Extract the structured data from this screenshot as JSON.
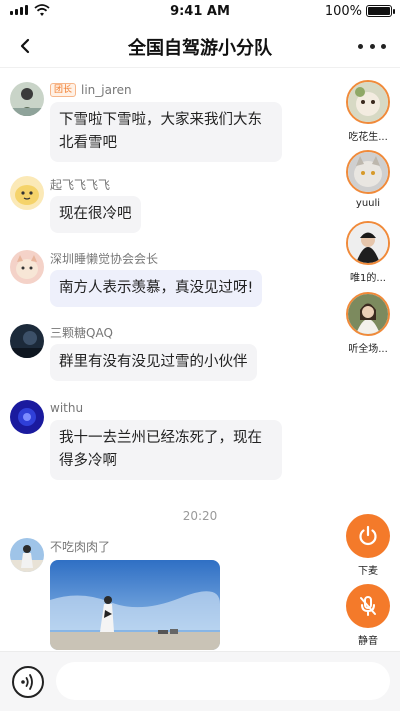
{
  "status_bar": {
    "time": "9:41 AM",
    "battery": "100%"
  },
  "header": {
    "title": "全国自驾游小分队",
    "back_icon": "chevron-left-icon",
    "more_icon": "more-horizontal-icon"
  },
  "messages": [
    {
      "nick": "lin_jaren",
      "badge": "团长",
      "text": "下雪啦下雪啦，大家来我们大东北看雪吧"
    },
    {
      "nick": "起飞飞飞飞",
      "text": "现在很冷吧"
    },
    {
      "nick": "深圳睡懒觉协会会长",
      "text": "南方人表示羡慕，真没见过呀!"
    },
    {
      "nick": "三颗糖QAQ",
      "text": "群里有没有没见过雪的小伙伴"
    },
    {
      "nick": "withu",
      "text": "我十一去兰州已经冻死了，现在得多冷啊"
    },
    {
      "nick": "不吃肉肉了"
    }
  ],
  "time_separator": "20:20",
  "seats": [
    {
      "label": "吃花生..."
    },
    {
      "label": "yuuli"
    },
    {
      "label": "唯1的..."
    },
    {
      "label": "听全场..."
    }
  ],
  "controls": {
    "hangup_label": "下麦",
    "mute_label": "静音",
    "hangup_icon": "power-icon",
    "mute_icon": "mic-off-icon"
  },
  "input": {
    "placeholder": "",
    "voice_icon": "voice-wave-icon"
  },
  "colors": {
    "accent": "#f47a2a",
    "bubble": "#f4f4f6",
    "bubble_blue": "#eef0fb"
  }
}
